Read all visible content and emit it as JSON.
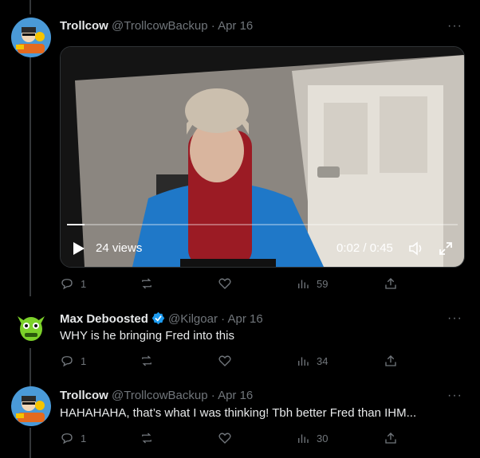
{
  "tweets": [
    {
      "display_name": "Trollcow",
      "handle": "@TrollcowBackup",
      "date": "Apr 16",
      "text": "",
      "video": {
        "views": "24 views",
        "time": "0:02 / 0:45",
        "progress": 0.044
      },
      "actions": {
        "replies": "1",
        "retweets": "",
        "likes": "",
        "views": "59"
      }
    },
    {
      "display_name": "Max Deboosted",
      "handle": "@Kilgoar",
      "date": "Apr 16",
      "verified": true,
      "text": "WHY is he bringing Fred into this",
      "actions": {
        "replies": "1",
        "retweets": "",
        "likes": "",
        "views": "34"
      }
    },
    {
      "display_name": "Trollcow",
      "handle": "@TrollcowBackup",
      "date": "Apr 16",
      "text": "HAHAHAHA, that’s what I was thinking! Tbh better Fred than IHM...",
      "actions": {
        "replies": "1",
        "retweets": "",
        "likes": "",
        "views": "30"
      }
    }
  ],
  "separator": "·",
  "more_glyph": "···",
  "colors": {
    "background": "#000000",
    "text": "#e7e9ea",
    "muted": "#71767b",
    "verified": "#1d9bf0"
  }
}
